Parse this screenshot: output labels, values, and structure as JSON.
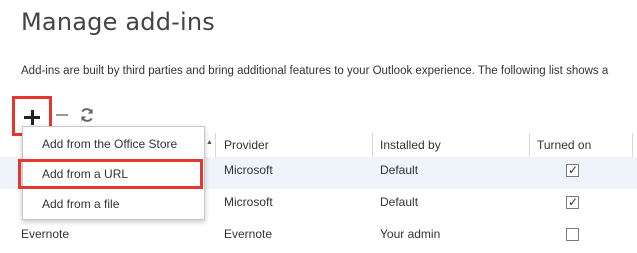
{
  "page": {
    "title": "Manage add-ins",
    "description": "Add-ins are built by third parties and bring additional features to your Outlook experience. The following list shows a"
  },
  "toolbar": {
    "add_icon": "plus-icon",
    "remove_icon": "minus-icon",
    "refresh_icon": "refresh-icon"
  },
  "menu": {
    "items": [
      {
        "label": "Add from the Office Store"
      },
      {
        "label": "Add from a URL"
      },
      {
        "label": "Add from a file"
      }
    ]
  },
  "table": {
    "columns": [
      "Provider",
      "Installed by",
      "Turned on"
    ],
    "rows": [
      {
        "name": "",
        "provider": "Microsoft",
        "installed_by": "Default",
        "turned_on": true
      },
      {
        "name": "",
        "provider": "Microsoft",
        "installed_by": "Default",
        "turned_on": true
      },
      {
        "name": "Evernote",
        "provider": "Evernote",
        "installed_by": "Your admin",
        "turned_on": false
      }
    ]
  },
  "colors": {
    "highlight_border": "#e5372e",
    "selected_row": "#eef4fa"
  }
}
